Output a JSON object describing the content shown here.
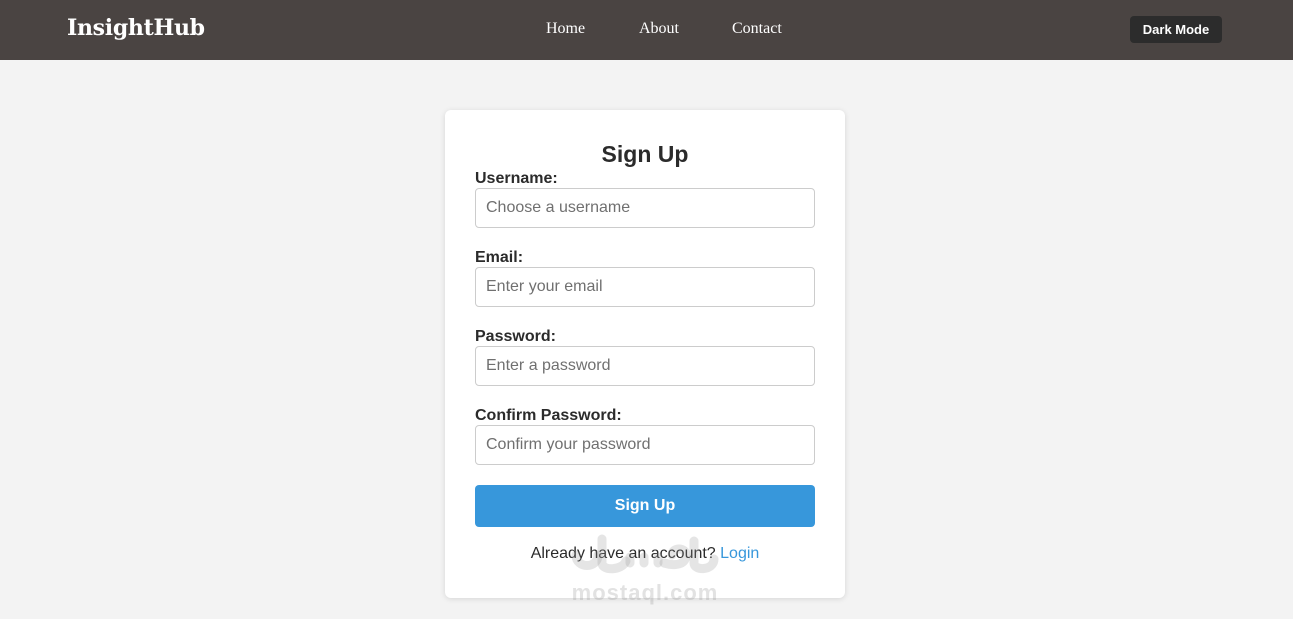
{
  "navbar": {
    "brand": "InsightHub",
    "links": [
      "Home",
      "About",
      "Contact"
    ],
    "dark_mode_label": "Dark Mode"
  },
  "form": {
    "title": "Sign Up",
    "fields": [
      {
        "label": "Username:",
        "placeholder": "Choose a username"
      },
      {
        "label": "Email:",
        "placeholder": "Enter your email"
      },
      {
        "label": "Password:",
        "placeholder": "Enter a password"
      },
      {
        "label": "Confirm Password:",
        "placeholder": "Confirm your password"
      }
    ],
    "submit_label": "Sign Up",
    "login_prompt": "Already have an account?",
    "login_link": "Login"
  },
  "watermark": {
    "text": "mostaql.com"
  },
  "colors": {
    "navbar_bg": "#4a4442",
    "page_bg": "#f3f3f3",
    "primary": "#3797db",
    "dark_button": "#2c2c2c"
  }
}
